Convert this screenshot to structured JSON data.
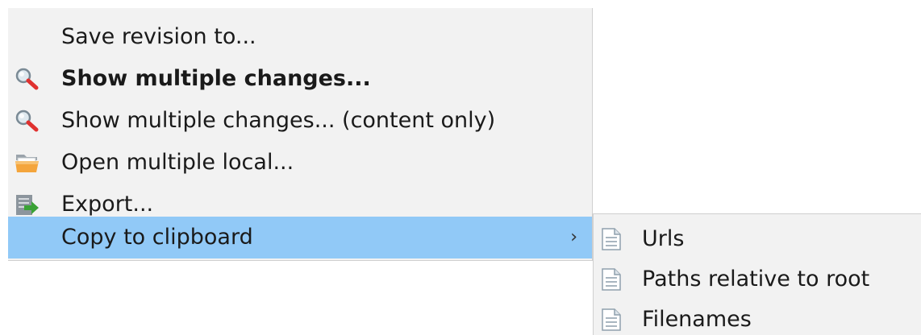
{
  "menu": {
    "items": [
      {
        "label": "Save revision to...",
        "icon": "",
        "bold": false
      },
      {
        "label": "Show multiple changes...",
        "icon": "magnifier-icon",
        "bold": true
      },
      {
        "label": "Show multiple changes... (content only)",
        "icon": "magnifier-icon",
        "bold": false
      },
      {
        "label": "Open multiple local...",
        "icon": "open-folder-icon",
        "bold": false
      },
      {
        "label": "Export...",
        "icon": "export-icon",
        "bold": false
      },
      {
        "label": "Copy to clipboard",
        "icon": "",
        "bold": false,
        "highlighted": true,
        "has_submenu": true,
        "arrow": "›"
      }
    ]
  },
  "submenu": {
    "items": [
      {
        "label": "Urls",
        "icon": "document-icon"
      },
      {
        "label": "Paths relative to root",
        "icon": "document-icon"
      },
      {
        "label": "Filenames",
        "icon": "document-icon"
      }
    ]
  },
  "colors": {
    "menu_background": "#f2f2f2",
    "highlight": "#91c9f7",
    "text": "#1a1a1a"
  }
}
